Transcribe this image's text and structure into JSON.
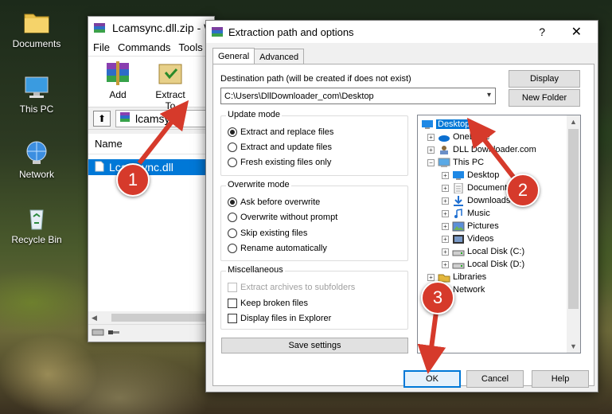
{
  "desktop": {
    "icons": [
      {
        "label": "Documents",
        "icon": "folder-icon"
      },
      {
        "label": "This PC",
        "icon": "computer-icon"
      },
      {
        "label": "Network",
        "icon": "network-icon"
      },
      {
        "label": "Recycle Bin",
        "icon": "recycle-bin-icon"
      }
    ]
  },
  "winrar": {
    "title": "Lcamsync.dll.zip - W",
    "menu": [
      "File",
      "Commands",
      "Tools"
    ],
    "toolbar": [
      {
        "label": "Add",
        "icon": "add-archive-icon"
      },
      {
        "label": "Extract To",
        "icon": "extract-to-icon"
      }
    ],
    "path": "lcamsync.",
    "column_name": "Name",
    "file": "Lcamsync.dll"
  },
  "dialog": {
    "title": "Extraction path and options",
    "help_glyph": "?",
    "close_glyph": "✕",
    "tabs": [
      "General",
      "Advanced"
    ],
    "dest_label": "Destination path (will be created if does not exist)",
    "dest_value": "C:\\Users\\DllDownloader_com\\Desktop",
    "display_btn": "Display",
    "new_folder_btn": "New Folder",
    "update_mode": {
      "title": "Update mode",
      "options": [
        {
          "label": "Extract and replace files",
          "checked": true
        },
        {
          "label": "Extract and update files",
          "checked": false
        },
        {
          "label": "Fresh existing files only",
          "checked": false
        }
      ]
    },
    "overwrite_mode": {
      "title": "Overwrite mode",
      "options": [
        {
          "label": "Ask before overwrite",
          "checked": true
        },
        {
          "label": "Overwrite without prompt",
          "checked": false
        },
        {
          "label": "Skip existing files",
          "checked": false
        },
        {
          "label": "Rename automatically",
          "checked": false
        }
      ]
    },
    "misc": {
      "title": "Miscellaneous",
      "options": [
        {
          "label": "Extract archives to subfolders",
          "checked": false,
          "disabled": true
        },
        {
          "label": "Keep broken files",
          "checked": false,
          "disabled": false
        },
        {
          "label": "Display files in Explorer",
          "checked": false,
          "disabled": false
        }
      ]
    },
    "save_settings_btn": "Save settings",
    "tree": [
      {
        "label": "Desktop",
        "level": 0,
        "icon": "desktop-icon",
        "selected": true,
        "exp": ""
      },
      {
        "label": "OneDrive",
        "level": 1,
        "icon": "cloud-icon",
        "exp": "+"
      },
      {
        "label": "DLL Downloader.com",
        "level": 1,
        "icon": "user-icon",
        "exp": "+"
      },
      {
        "label": "This PC",
        "level": 1,
        "icon": "computer-icon",
        "exp": "−"
      },
      {
        "label": "Desktop",
        "level": 2,
        "icon": "desktop-icon",
        "exp": "+"
      },
      {
        "label": "Documents",
        "level": 2,
        "icon": "documents-icon",
        "exp": "+"
      },
      {
        "label": "Downloads",
        "level": 2,
        "icon": "download-icon",
        "exp": "+"
      },
      {
        "label": "Music",
        "level": 2,
        "icon": "music-icon",
        "exp": "+"
      },
      {
        "label": "Pictures",
        "level": 2,
        "icon": "pictures-icon",
        "exp": "+"
      },
      {
        "label": "Videos",
        "level": 2,
        "icon": "videos-icon",
        "exp": "+"
      },
      {
        "label": "Local Disk (C:)",
        "level": 2,
        "icon": "drive-icon",
        "exp": "+"
      },
      {
        "label": "Local Disk (D:)",
        "level": 2,
        "icon": "drive-icon",
        "exp": "+"
      },
      {
        "label": "Libraries",
        "level": 1,
        "icon": "libraries-icon",
        "exp": "+"
      },
      {
        "label": "Network",
        "level": 1,
        "icon": "network-icon",
        "exp": "+"
      }
    ],
    "ok_btn": "OK",
    "cancel_btn": "Cancel",
    "help_btn": "Help"
  },
  "markers": [
    "1",
    "2",
    "3"
  ],
  "colors": {
    "accent": "#0078d7",
    "marker": "#d63a2b"
  }
}
